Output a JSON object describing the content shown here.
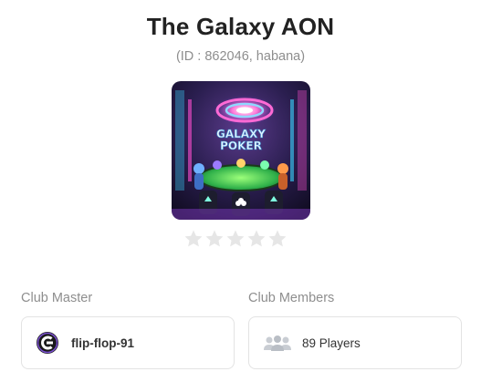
{
  "club": {
    "name": "The Galaxy AON",
    "id_line": "(ID : 862046, habana)",
    "logo": {
      "icon": "galaxy-poker-logo",
      "text_line1": "GALAXY",
      "text_line2": "POKER"
    },
    "rating": {
      "stars_filled": 0,
      "stars_total": 5,
      "empty_color": "#e6e6e6"
    }
  },
  "master": {
    "label": "Club Master",
    "name": "flip-flop-91",
    "avatar_icon": "club-avatar-icon"
  },
  "members": {
    "label": "Club Members",
    "count_text": "89 Players",
    "icon": "players-group-icon"
  }
}
